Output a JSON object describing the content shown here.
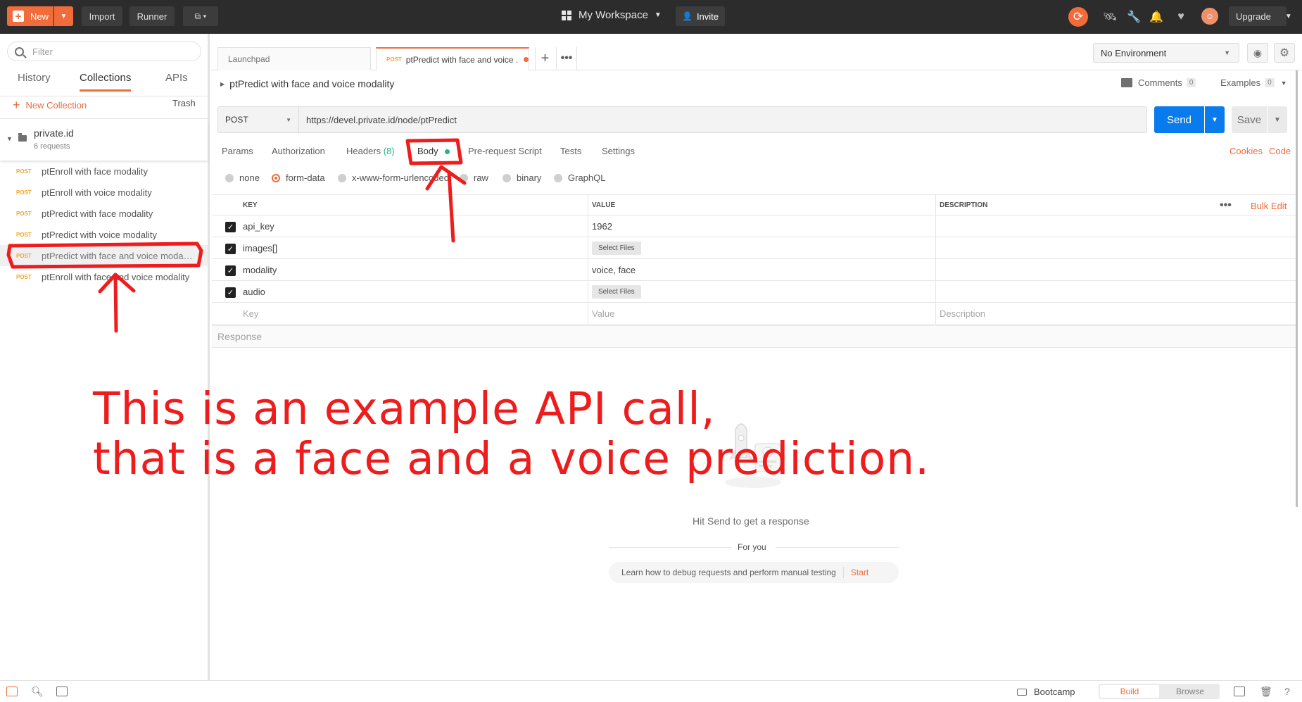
{
  "topbar": {
    "new_label": "New",
    "import_label": "Import",
    "runner_label": "Runner",
    "workspace_label": "My Workspace",
    "invite_label": "Invite",
    "upgrade_label": "Upgrade"
  },
  "sidebar": {
    "filter_placeholder": "Filter",
    "tabs": [
      {
        "label": "History",
        "active": false
      },
      {
        "label": "Collections",
        "active": true
      },
      {
        "label": "APIs",
        "active": false
      }
    ],
    "new_collection_label": "New Collection",
    "trash_label": "Trash",
    "collection": {
      "name": "private.id",
      "count": "6 requests"
    },
    "requests": [
      {
        "method": "POST",
        "name": "ptEnroll with face modality"
      },
      {
        "method": "POST",
        "name": "ptEnroll with voice modality"
      },
      {
        "method": "POST",
        "name": "ptPredict with face modality"
      },
      {
        "method": "POST",
        "name": "ptPredict with voice modality"
      },
      {
        "method": "POST",
        "name": "ptPredict with face and voice modal..."
      },
      {
        "method": "POST",
        "name": "ptEnroll with face and voice modality"
      }
    ]
  },
  "tabs": [
    {
      "label": "Launchpad"
    },
    {
      "method": "POST",
      "label": "ptPredict with face and voice ..."
    }
  ],
  "environment": {
    "selected": "No Environment"
  },
  "request": {
    "title": "ptPredict with face and voice modality",
    "comments_label": "Comments",
    "comments_count": "0",
    "examples_label": "Examples",
    "examples_count": "0",
    "method": "POST",
    "url": "https://devel.private.id/node/ptPredict",
    "send_label": "Send",
    "save_label": "Save",
    "tabs": {
      "params": "Params",
      "authorization": "Authorization",
      "headers": "Headers",
      "headers_count": "(8)",
      "body": "Body",
      "prerequest": "Pre-request Script",
      "tests": "Tests",
      "settings": "Settings"
    },
    "cookies_label": "Cookies",
    "code_label": "Code",
    "body_types": [
      "none",
      "form-data",
      "x-www-form-urlencoded",
      "raw",
      "binary",
      "GraphQL"
    ],
    "body_type_selected": "form-data",
    "table": {
      "headers": {
        "key": "KEY",
        "value": "VALUE",
        "description": "DESCRIPTION"
      },
      "bulk_edit": "Bulk Edit",
      "rows": [
        {
          "key": "api_key",
          "value": "1962",
          "description": ""
        },
        {
          "key": "images[]",
          "value": "Select Files",
          "description": ""
        },
        {
          "key": "modality",
          "value": "voice, face",
          "description": ""
        },
        {
          "key": "audio",
          "value": "Select Files",
          "description": ""
        }
      ],
      "placeholder": {
        "key": "Key",
        "value": "Value",
        "description": "Description"
      }
    }
  },
  "response": {
    "label": "Response",
    "hint": "Hit Send to get a response",
    "for_you": "For you",
    "learn_text": "Learn how to debug requests and perform manual testing",
    "start_label": "Start"
  },
  "statusbar": {
    "bootcamp_label": "Bootcamp",
    "build_label": "Build",
    "browse_label": "Browse"
  },
  "annotation": {
    "line1": "This is an example API call,",
    "line2": "that is a face and a voice prediction.",
    "color": "#ee1c1c"
  },
  "colors": {
    "accent": "#f26b3a",
    "send": "#097bed",
    "topbar": "#2c2c2c",
    "method_post": "#f5a623"
  }
}
